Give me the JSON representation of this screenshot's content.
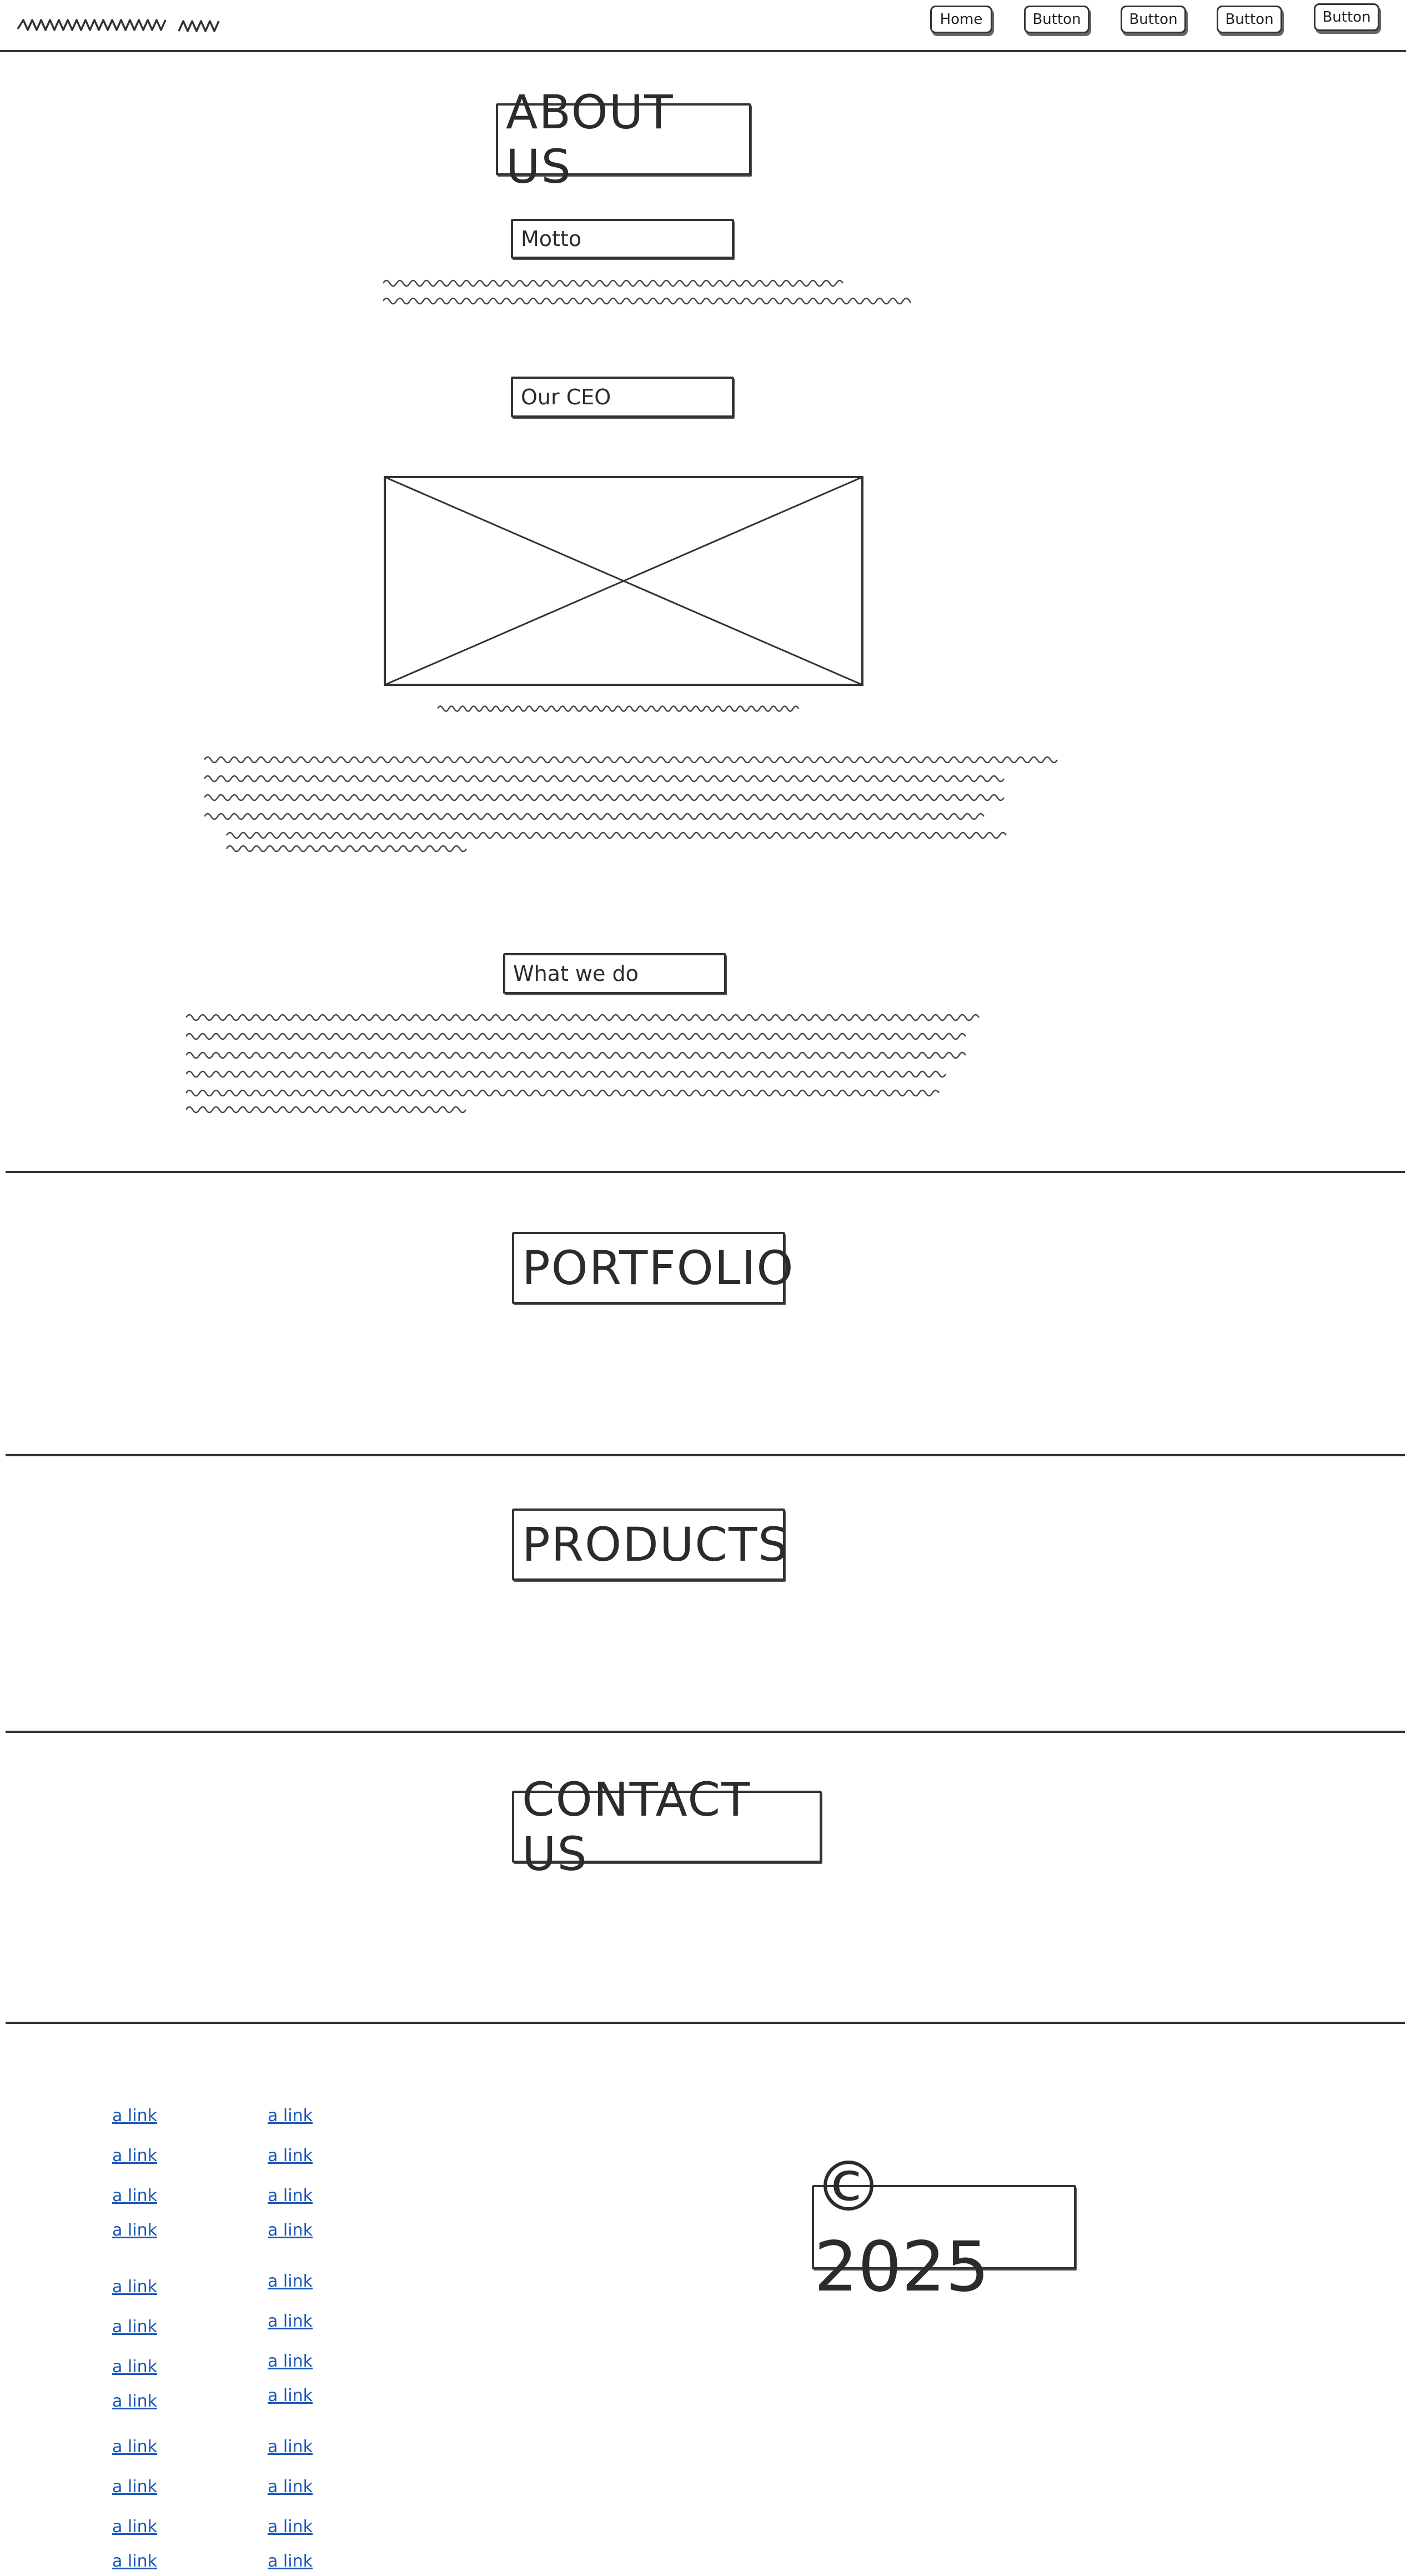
{
  "header": {
    "nav": [
      "Home",
      "Button",
      "Button",
      "Button",
      "Button"
    ]
  },
  "about": {
    "title": "ABOUT US",
    "motto_heading": "Motto",
    "ceo_heading": "Our CEO",
    "what_heading": "What we do"
  },
  "portfolio": {
    "title": "PORTFOLIO"
  },
  "products": {
    "title": "PRODUCTS"
  },
  "contact": {
    "title": "CONTACT US"
  },
  "footer": {
    "links_col1": [
      "a link",
      "a link",
      "a link",
      "a link",
      "a link",
      "a link",
      "a link",
      "a link",
      "a link",
      "a link",
      "a link",
      "a link"
    ],
    "links_col2": [
      "a link",
      "a link",
      "a link",
      "a link",
      "a link",
      "a link",
      "a link",
      "a link",
      "a link",
      "a link",
      "a link",
      "a link"
    ],
    "copyright": "© 2025"
  },
  "icons": {
    "logo": "scribble-logo",
    "image_placeholder": "image-placeholder-icon"
  }
}
